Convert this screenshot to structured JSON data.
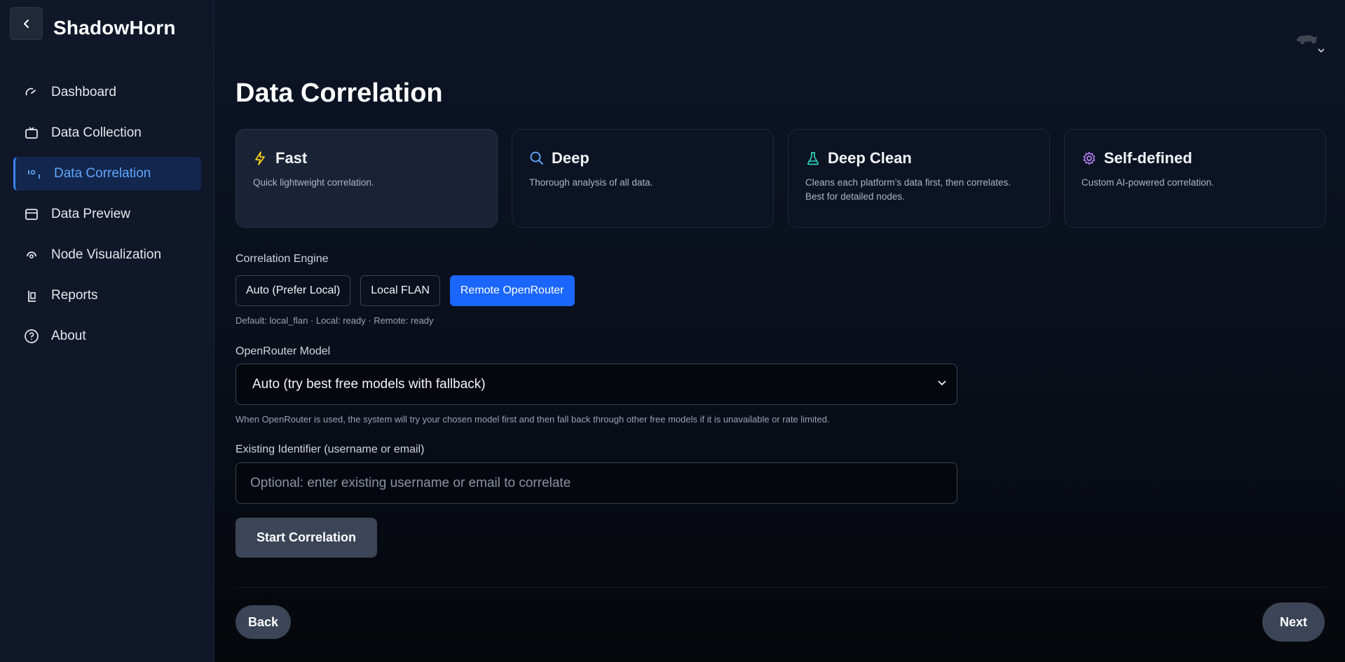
{
  "app": {
    "title": "ShadowHorn"
  },
  "sidebar": {
    "items": [
      {
        "label": "Dashboard",
        "icon": "gauge-icon"
      },
      {
        "label": "Data Collection",
        "icon": "tv-icon"
      },
      {
        "label": "Data Correlation",
        "icon": "binary-icon",
        "active": true
      },
      {
        "label": "Data Preview",
        "icon": "window-icon"
      },
      {
        "label": "Node Visualization",
        "icon": "radar-icon"
      },
      {
        "label": "Reports",
        "icon": "clipboard-icon"
      },
      {
        "label": "About",
        "icon": "help-circle-icon"
      }
    ]
  },
  "main": {
    "page_title": "Data Correlation",
    "modes": [
      {
        "title": "Fast",
        "desc": "Quick lightweight correlation.",
        "icon": "lightning-icon",
        "color": "#facc15",
        "selected": true
      },
      {
        "title": "Deep",
        "desc": "Thorough analysis of all data.",
        "icon": "search-icon",
        "color": "#60a5fa"
      },
      {
        "title": "Deep Clean",
        "desc_line1": "Cleans each platform’s data first, then correlates.",
        "desc_line2": "Best for detailed nodes.",
        "icon": "flask-icon",
        "color": "#2dd4bf"
      },
      {
        "title": "Self-defined",
        "desc": "Custom AI-powered correlation.",
        "icon": "gear-icon",
        "color": "#c084fc"
      }
    ],
    "engine": {
      "label": "Correlation Engine",
      "options": [
        "Auto (Prefer Local)",
        "Local FLAN",
        "Remote OpenRouter"
      ],
      "selected": "Remote OpenRouter",
      "status": "Default: local_flan · Local: ready · Remote: ready"
    },
    "model": {
      "label": "OpenRouter Model",
      "value": "Auto (try best free models with fallback)",
      "hint": "When OpenRouter is used, the system will try your chosen model first and then fall back through other free models if it is unavailable or rate limited."
    },
    "identifier": {
      "label": "Existing Identifier (username or email)",
      "placeholder": "Optional: enter existing username or email to correlate",
      "value": ""
    },
    "start_label": "Start Correlation",
    "back_label": "Back",
    "next_label": "Next"
  },
  "colors": {
    "accent": "#1a66ff",
    "active_nav_bg": "#13274e",
    "active_nav_text": "#60a5fa"
  }
}
